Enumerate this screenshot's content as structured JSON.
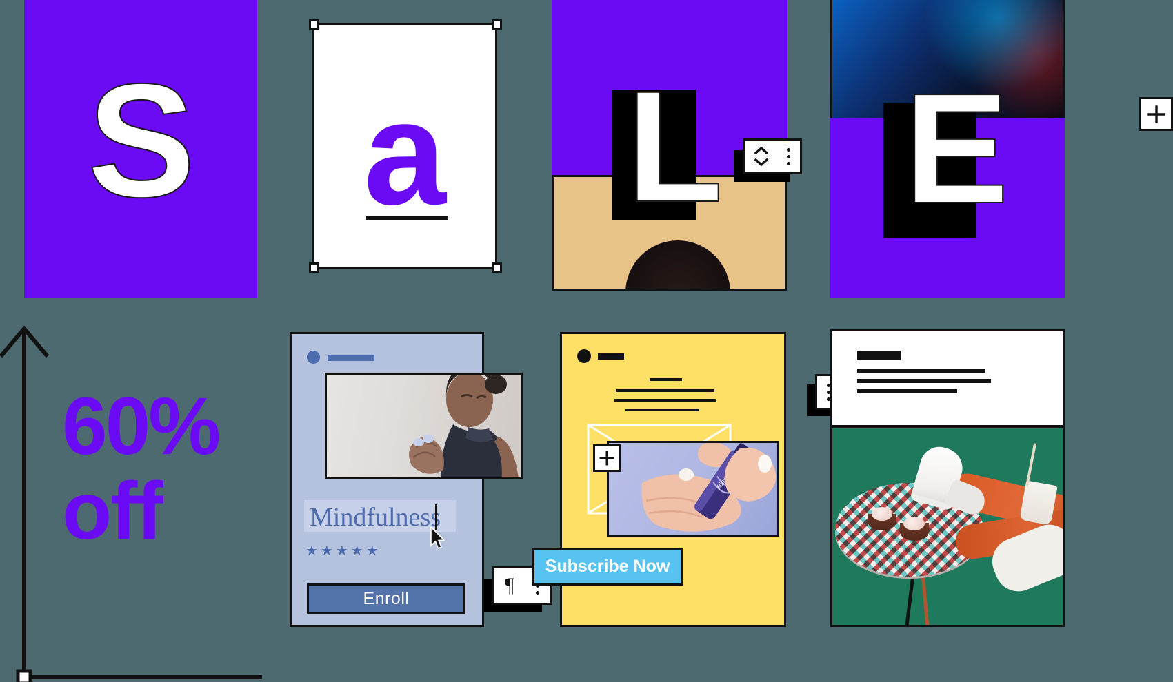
{
  "canvas": {
    "background_color": "#4d6a70",
    "accent_purple": "#6b0bf5",
    "accent_yellow": "#ffe066",
    "accent_blue": "#58c2f0",
    "card_lavender": "#b4c2de"
  },
  "headline": {
    "letters": [
      "S",
      "a",
      "L",
      "E"
    ],
    "letter_s": "S",
    "letter_a": "a",
    "letter_l": "L",
    "letter_e": "E"
  },
  "promo": {
    "percent": "60%",
    "off": "off"
  },
  "toolbars": {
    "letter_l_toolbar": {
      "stepper_up_icon": "chevron-up-icon",
      "stepper_down_icon": "chevron-down-icon",
      "overflow_icon": "vertical-dots-icon"
    },
    "yellow_card_toolbar": {
      "overflow_icon": "vertical-dots-icon",
      "stepper_up_icon": "chevron-up-icon",
      "stepper_down_icon": "chevron-down-icon"
    },
    "mindfulness_toolbar": {
      "paragraph_label": "¶",
      "paragraph_icon": "paragraph-icon",
      "overflow_icon": "vertical-dots-icon"
    },
    "add_image_chip": {
      "icon": "plus-icon"
    },
    "top_right_chip": {
      "icon": "plus-icon"
    }
  },
  "mindfulness_card": {
    "title": "Mindfulness",
    "rating_stars": "★★★★★",
    "rating_value": 5,
    "cta_label": "Enroll",
    "avatar_icon": "avatar-circle-icon",
    "photo_alt": "woman-meditating-photo"
  },
  "curology_card": {
    "cta_label": "Subscribe Now",
    "brand_on_bottle": "Curology",
    "avatar_icon": "avatar-circle-icon",
    "photo_alt": "hands-holding-serum-bottle-photo"
  },
  "bottom_right_panel": {
    "photo_alt": "legs-on-cafe-table-photo"
  },
  "selection": {
    "handle_icon": "resize-handle-icon",
    "cursor_icon": "mouse-pointer-icon",
    "text_caret_icon": "text-caret-icon",
    "axis_arrow_icon": "arrow-up-icon"
  }
}
